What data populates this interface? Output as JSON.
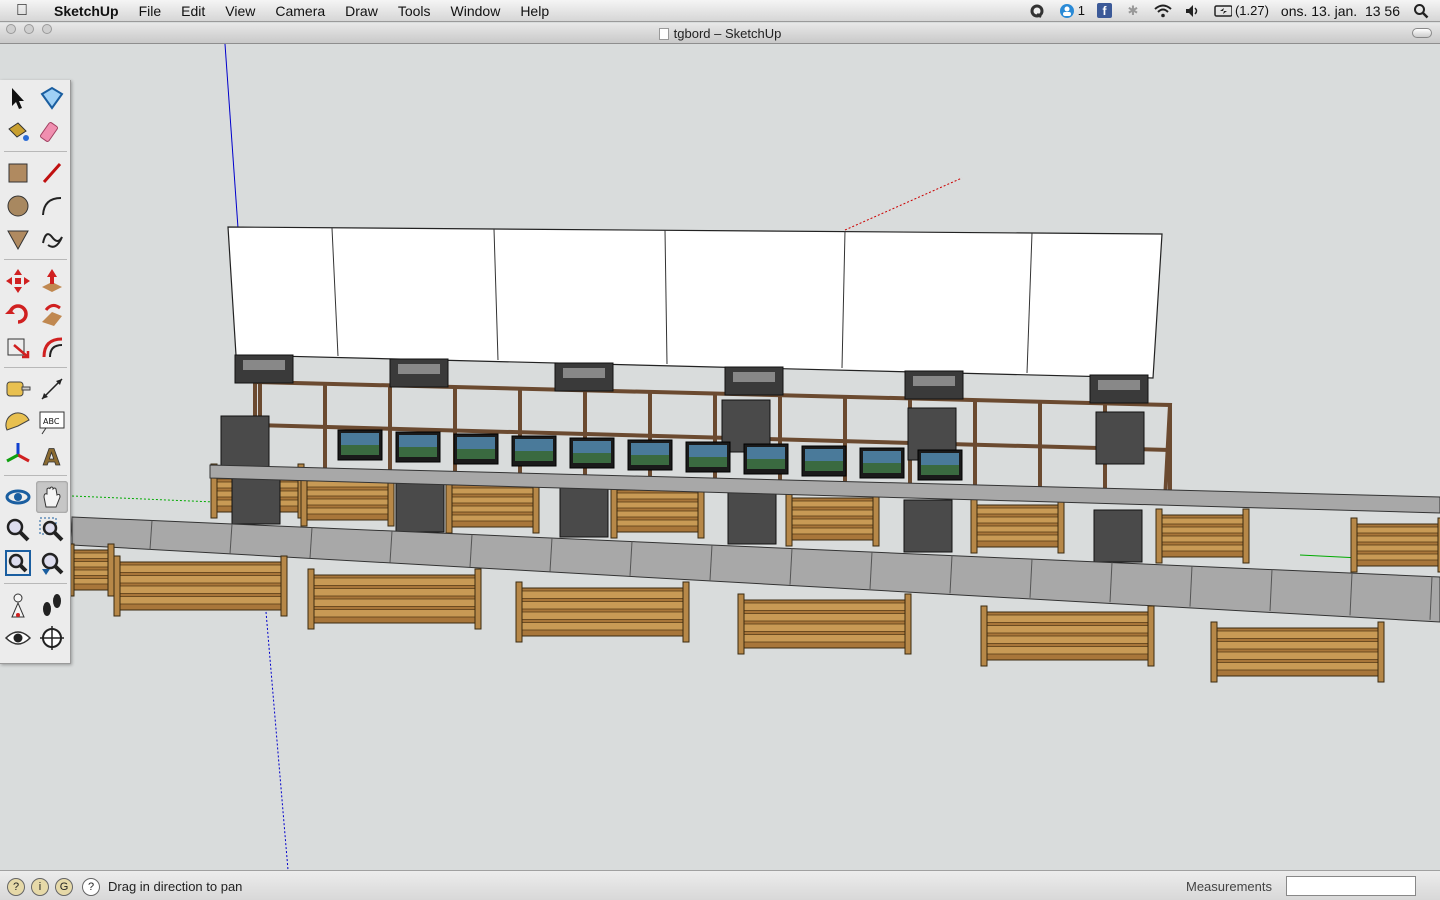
{
  "menubar": {
    "apple_icon": "apple-logo-icon",
    "app_name": "SketchUp",
    "menus": [
      "File",
      "Edit",
      "View",
      "Camera",
      "Draw",
      "Tools",
      "Window",
      "Help"
    ],
    "badge_count": "1",
    "facebook_label": "f",
    "battery_text": "(1.27)",
    "clock": "ons. 13. jan.  13 56"
  },
  "window": {
    "title": "tgbord – SketchUp"
  },
  "toolbar": {
    "tools": [
      "select-tool-icon",
      "make-component-tool-icon",
      "paint-bucket-tool-icon",
      "eraser-tool-icon",
      "rectangle-tool-icon",
      "line-tool-icon",
      "circle-tool-icon",
      "arc-tool-icon",
      "polygon-tool-icon",
      "freehand-tool-icon",
      "move-tool-icon",
      "push-pull-tool-icon",
      "rotate-tool-icon",
      "follow-me-tool-icon",
      "scale-tool-icon",
      "offset-tool-icon",
      "tape-measure-tool-icon",
      "dimension-tool-icon",
      "protractor-tool-icon",
      "text-tool-icon",
      "axes-tool-icon",
      "3d-text-tool-icon",
      "orbit-tool-icon",
      "pan-tool-icon",
      "zoom-tool-icon",
      "zoom-window-tool-icon",
      "zoom-extents-tool-icon",
      "previous-view-tool-icon",
      "position-camera-tool-icon",
      "walk-tool-icon",
      "look-around-tool-icon",
      "section-plane-tool-icon"
    ],
    "text_tool_label": "ABC",
    "active_tool": "pan-tool-icon"
  },
  "statusbar": {
    "status_text": "Drag in direction to pan",
    "measurements_label": "Measurements",
    "measurements_value": ""
  },
  "colors": {
    "viewport_bg": "#d9dcdc",
    "pallet_wood": "#c89a55",
    "table_top": "#a8a8a8",
    "wall": "#ffffff",
    "axis_blue": "#0000cc",
    "axis_red": "#cc0000",
    "axis_green": "#00aa00"
  }
}
